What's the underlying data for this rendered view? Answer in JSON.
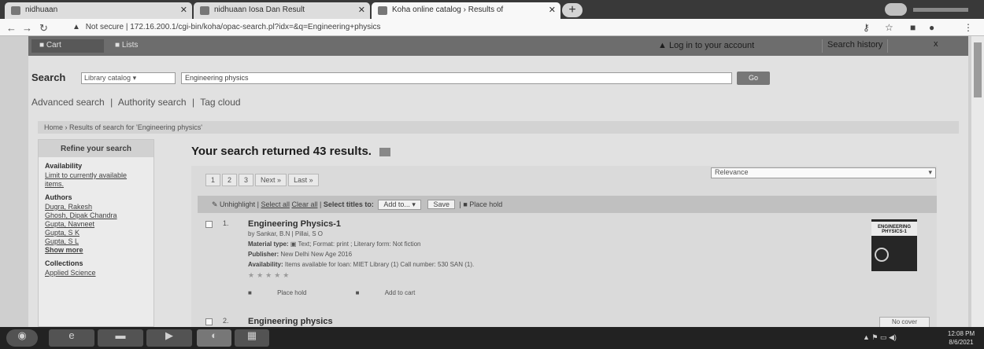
{
  "browser": {
    "tabs": [
      {
        "label": "nidhuaan"
      },
      {
        "label": "nidhuaan Iosa Dan Result"
      },
      {
        "label": "Koha online catalog › Results of"
      }
    ],
    "address": {
      "security": "Not secure",
      "url": "172.16.200.1/cgi-bin/koha/opac-search.pl?idx=&q=Engineering+physics"
    }
  },
  "koha_nav": {
    "cart": "Cart",
    "lists": "Lists",
    "login": "Log in to your account",
    "search_history": "Search history",
    "close": "x"
  },
  "search": {
    "label": "Search",
    "scope": "Library catalog",
    "query": "Engineering physics",
    "go": "Go"
  },
  "advanced": {
    "advanced_search": "Advanced search",
    "authority_search": "Authority search",
    "tag_cloud": "Tag cloud"
  },
  "breadcrumb": "Home › Results of search for 'Engineering physics'",
  "sidebar": {
    "refine": "Refine your search",
    "availability_heading": "Availability",
    "availability_link": "Limit to currently available items.",
    "authors_heading": "Authors",
    "authors": [
      "Dugra, Rakesh",
      "Ghosh, Dipak Chandra",
      "Gupta, Navneet",
      "Gupta, S K",
      "Gupta, S L"
    ],
    "show_more": "Show more",
    "collections_heading": "Collections",
    "collection_link": "Applied Science"
  },
  "results": {
    "summary": "Your search returned 43 results.",
    "pagination": [
      "1",
      "2",
      "3",
      "Next »",
      "Last »"
    ],
    "sort": "Relevance",
    "actionbar": {
      "unhighlight": "Unhighlight",
      "select_all": "Select all",
      "clear_all": "Clear all",
      "select_titles": "Select titles to:",
      "add_to": "Add to...",
      "save": "Save",
      "place_hold": "Place hold"
    },
    "items": [
      {
        "number": "1.",
        "title": "Engineering Physics-1",
        "author": "by Sankar, B.N | Pillai, S O",
        "material_label": "Material type:",
        "material": "Text; Format: print ; Literary form: Not fiction",
        "publisher_label": "Publisher:",
        "publisher": "New Delhi New Age 2016",
        "availability_label": "Availability:",
        "availability": "Items available for loan: MIET Library (1) Call number: 530 SAN (1).",
        "stars": "★★★★★",
        "place_hold": "Place hold",
        "add_to_cart": "Add to cart",
        "cover_text": "ENGINEERING PHYSICS-1"
      },
      {
        "number": "2.",
        "title": "Engineering physics",
        "browse": "No cover"
      }
    ]
  },
  "taskbar": {
    "tray": "▲ ⚑ ▭ ◀)",
    "time": "12:08 PM",
    "date": "8/6/2021"
  }
}
